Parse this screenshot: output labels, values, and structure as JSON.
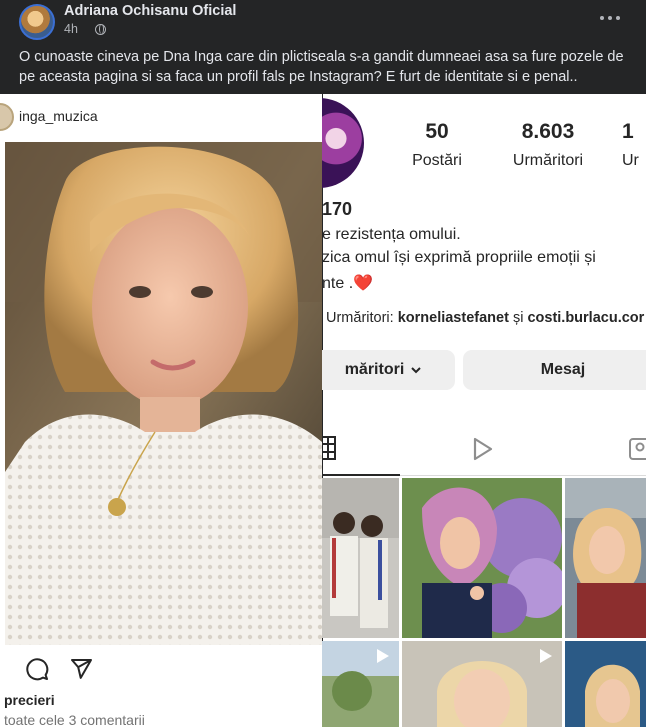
{
  "post": {
    "author": "Adriana Ochisanu Oficial",
    "time": "4h",
    "more_icon": "more-horizontal-icon",
    "text": "O cunoaste cineva pe Dna Inga care din plictiseala s-a gandit dumneaei asa sa fure pozele de pe aceasta pagina si sa faca un profil fals pe Instagram? E furt de identitate si e penal.."
  },
  "ig_post": {
    "username": "inga_muzica",
    "likes_text": "precieri",
    "comments_text": "toate cele 3 comentarii",
    "icons": [
      "comment-icon",
      "share-icon"
    ]
  },
  "ig_profile": {
    "stats": [
      {
        "value": "50",
        "label": "Postări"
      },
      {
        "value": "8.603",
        "label": "Urmăritori"
      },
      {
        "value": "1",
        "label": "Ur"
      }
    ],
    "name_fragment": "170",
    "bio_lines": [
      "e rezistența omului.",
      "zica omul își exprimă propriile emoții și",
      "nte ."
    ],
    "heart": "❤️",
    "followers_prefix": "Urmăritori: ",
    "follower_1": "korneliastefanet",
    "followers_and": " și ",
    "follower_2": "costi.burlacu.cor",
    "follow_button": "măritori",
    "message_button": "Mesaj",
    "tabs": [
      "grid-icon",
      "reels-icon",
      "tagged-icon"
    ]
  },
  "colors": {
    "fb_background": "#242526",
    "fb_text": "#e4e6eb",
    "fb_secondary": "#b0b3b8",
    "ig_text": "#262626",
    "ig_button": "#efefef",
    "heart": "#ed4956"
  }
}
